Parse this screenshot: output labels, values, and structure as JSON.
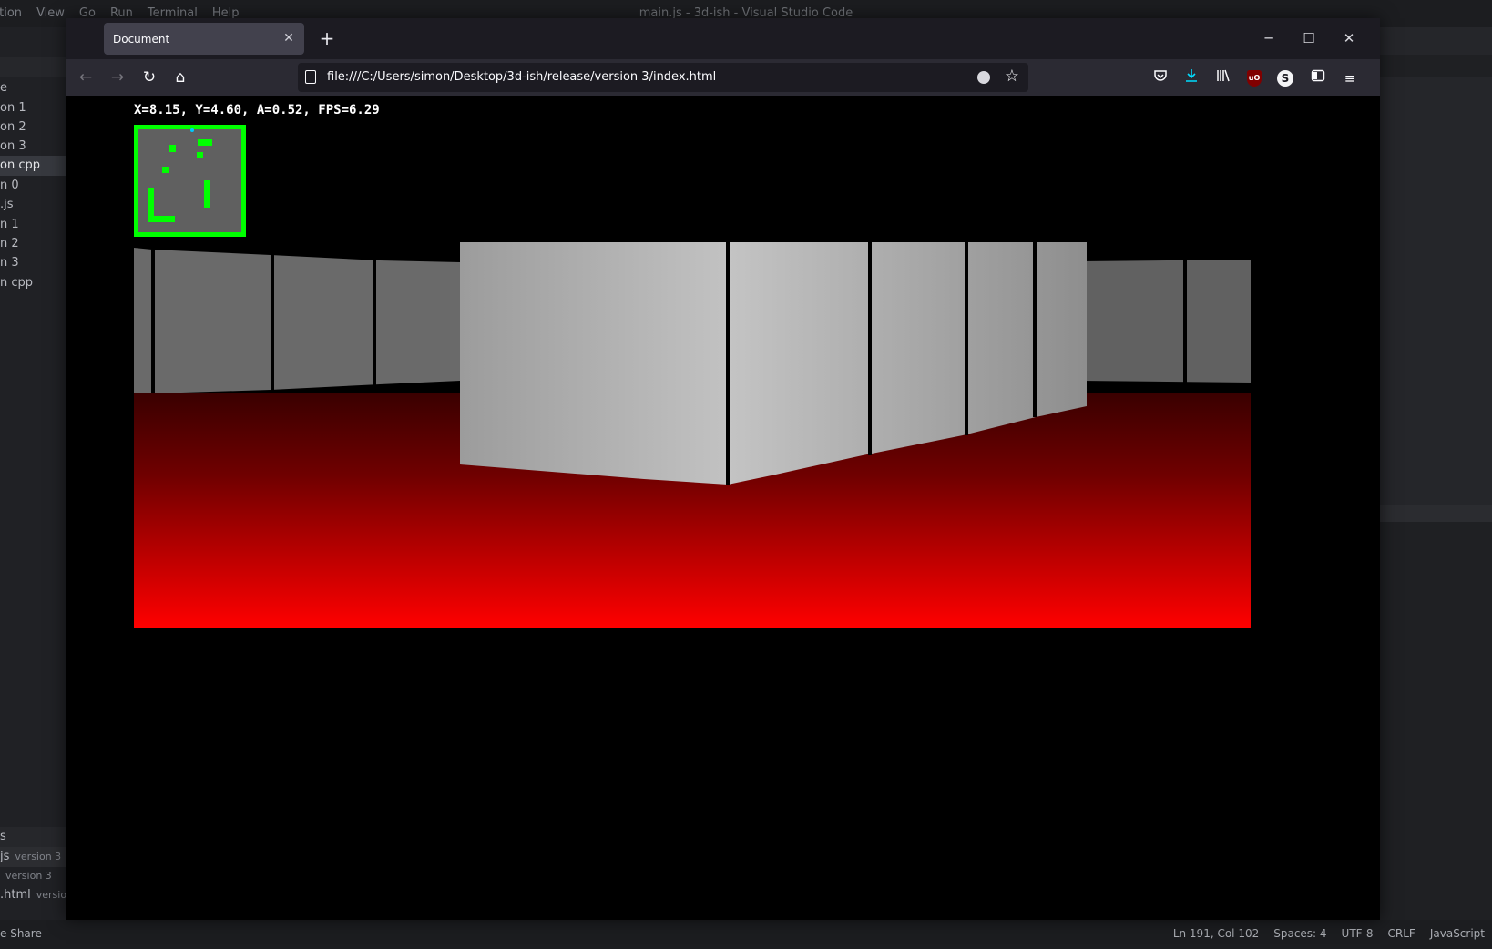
{
  "vscode": {
    "menu": [
      "ction",
      "View",
      "Go",
      "Run",
      "Terminal",
      "Help"
    ],
    "title": "main.js - 3d-ish - Visual Studio Code",
    "explorer_items": [
      "e",
      "on 1",
      "on 2",
      "on 3",
      "on cpp",
      "n 0",
      ".js",
      "n 1",
      "n 2",
      "n 3",
      "n cpp"
    ],
    "selected_index": 4,
    "open_editors_header": "s",
    "open_editors": [
      {
        "name": "js",
        "folder": "version 3"
      },
      {
        "name": "",
        "folder": "version 3"
      },
      {
        "name": ".html",
        "folder": "version"
      }
    ],
    "status_left": "e Share",
    "status_right": [
      "Ln 191, Col 102",
      "Spaces: 4",
      "UTF-8",
      "CRLF",
      "JavaScript"
    ]
  },
  "browser": {
    "tab_title": "Document",
    "tab_close_icon": "close-icon",
    "new_tab_label": "+",
    "url": "file:///C:/Users/simon/Desktop/3d-ish/release/version 3/index.html",
    "window_buttons": [
      "minimize-icon",
      "maximize-icon",
      "close-icon"
    ],
    "toolbar_icons": [
      "pocket-icon",
      "download-icon",
      "library-icon",
      "ublock-icon",
      "extension-s-icon",
      "sidebar-icon",
      "menu-icon"
    ],
    "colors": {
      "chrome_dark": "#1c1b22",
      "navbar": "#2b2a33",
      "tab_active": "#42414d",
      "download_accent": "#00ddff"
    }
  },
  "game": {
    "hud": "X=8.15, Y=4.60, A=0.52, FPS=6.29",
    "colors": {
      "wall": "#c0c0c0",
      "floor_far": "#3a0000",
      "floor_near": "#ff0000",
      "map_wall": "#00ff00",
      "map_floor": "#606060",
      "player": "#00c8ff"
    }
  }
}
